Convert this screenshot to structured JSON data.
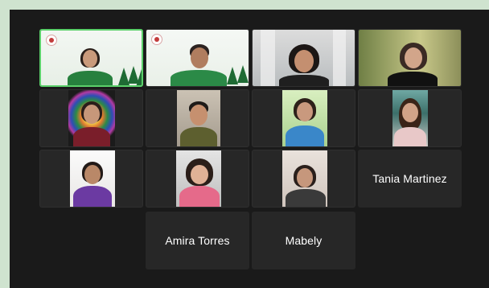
{
  "participants": [
    {
      "id": "p1",
      "name": ""
    },
    {
      "id": "p2",
      "name": ""
    },
    {
      "id": "p3",
      "name": ""
    },
    {
      "id": "p4",
      "name": ""
    },
    {
      "id": "p5",
      "name": ""
    },
    {
      "id": "p6",
      "name": ""
    },
    {
      "id": "p7",
      "name": ""
    },
    {
      "id": "p8",
      "name": ""
    },
    {
      "id": "p9",
      "name": ""
    },
    {
      "id": "p10",
      "name": ""
    },
    {
      "id": "p11",
      "name": ""
    },
    {
      "id": "p12",
      "name": "Tania Martinez"
    },
    {
      "id": "p13",
      "name": "Amira Torres"
    },
    {
      "id": "p14",
      "name": "Mabely"
    }
  ],
  "colors": {
    "background": "#cfe3cf",
    "grid": "#1a1a1a",
    "tile": "#272727",
    "active_speaker_border": "#5bd06a",
    "name_text": "#ffffff"
  }
}
